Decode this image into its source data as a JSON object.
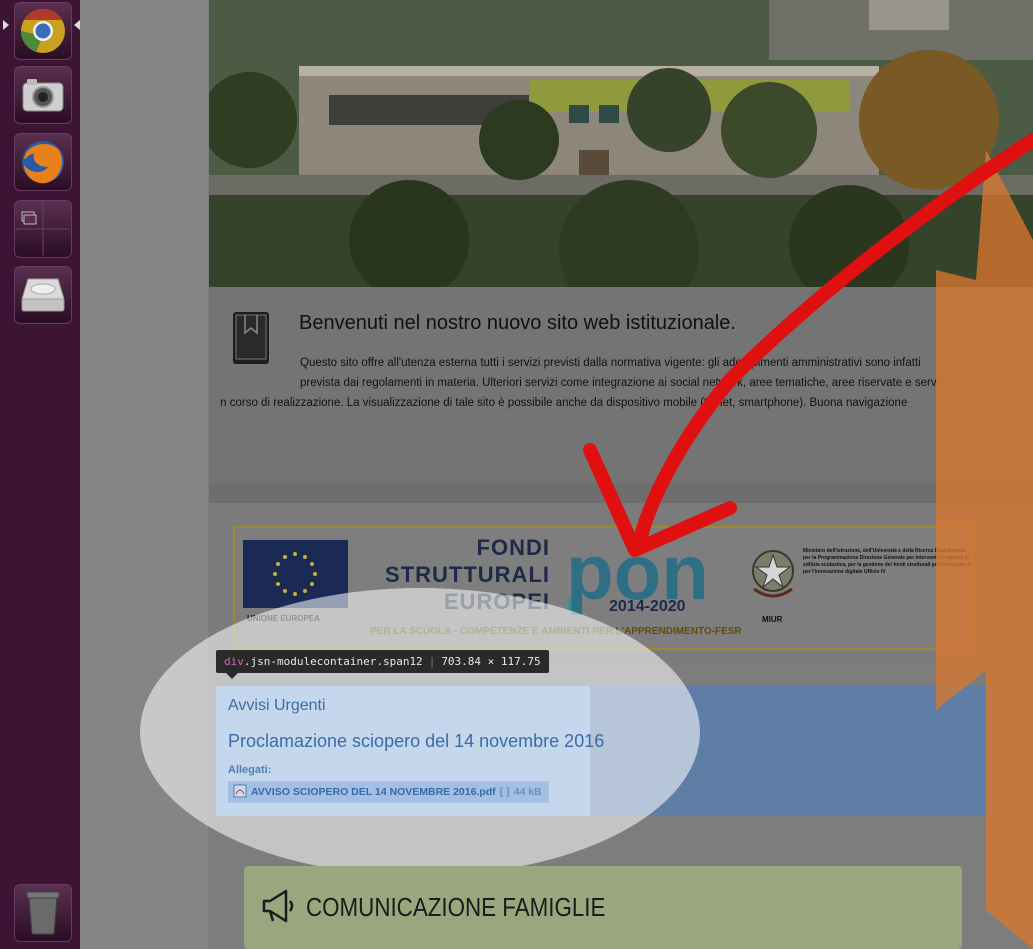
{
  "launcher": {
    "items": [
      {
        "name": "chrome-icon"
      },
      {
        "name": "camera-icon"
      },
      {
        "name": "firefox-icon"
      },
      {
        "name": "workspace-switcher-icon"
      },
      {
        "name": "disk-drive-icon"
      },
      {
        "name": "trash-icon"
      }
    ]
  },
  "welcome": {
    "title": "Benvenuti nel nostro nuovo sito web istituzionale.",
    "line1": "Questo sito offre all'utenza esterna tutti i servizi previsti dalla normativa vigente: gli adempimenti amministrativi sono infatti",
    "line2": "prevista dai regolamenti in materia. Ulteriori servizi come integrazione ai social network, aree tematiche, aree riservate e serv",
    "line3": "o in corso di realizzazione. La visualizzazione di tale sito è possibile anche da dispositivo mobile (tablet, smartphone). Buona navigazione"
  },
  "banner": {
    "eu_label": "UNIONE EUROPEA",
    "fondi_line1": "FONDI",
    "fondi_line2": "STRUTTURALI",
    "fondi_line3": "EUROPEI",
    "pon_word": "pon",
    "pon_years": "2014-2020",
    "subtitle": "PER LA SCUOLA - COMPETENZE E AMBIENTI PER L'APPRENDIMENTO-FESR",
    "miur_label": "MIUR",
    "miur_text": "Ministero dell'Istruzione, dell'Università e della Ricerca Dipartimento per la Programmazione Direzione Generale per interventi in materia di edilizia scolastica, per la gestione dei fondi strutturali per l'istruzione e per l'innovazione digitale Ufficio IV"
  },
  "tooltip": {
    "tag": "div",
    "classes": ".jsn-modulecontainer.span12",
    "size": "703.84 × 117.75"
  },
  "avvisi": {
    "title": "Avvisi Urgenti",
    "headline": "Proclamazione sciopero del 14 novembre 2016",
    "allegati_label": "Allegati:",
    "attachment_name": "AVVISO SCIOPERO DEL 14 NOVEMBRE 2016.pdf",
    "attachment_brackets": "[ ]",
    "attachment_size": "44 kB"
  },
  "comunicazione": {
    "title": "COMUNICAZIONE FAMIGLIE"
  },
  "colors": {
    "launcher_bg": "#3d1433",
    "highlight_blue": "#7ea6d6",
    "link_blue": "#3b6ca8",
    "annotation_red": "#e01010",
    "annotation_orange": "#d9772e"
  }
}
